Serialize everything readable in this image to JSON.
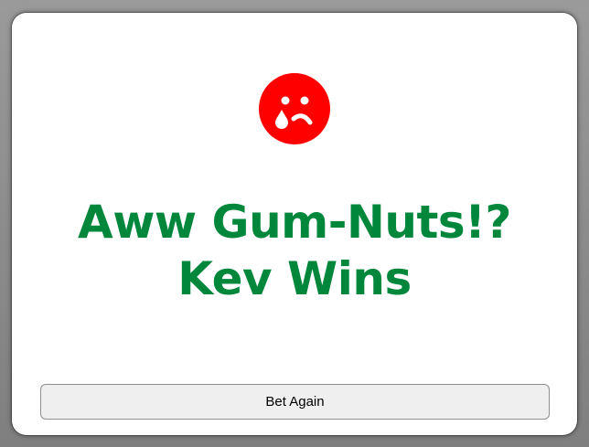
{
  "dialog": {
    "icon": "crying-sad-face-icon",
    "icon_color": "#ff0000",
    "headline_line1": "Aww Gum-Nuts!?",
    "headline_line2": "Kev Wins",
    "headline_color": "#00873c",
    "button_label": "Bet Again"
  }
}
